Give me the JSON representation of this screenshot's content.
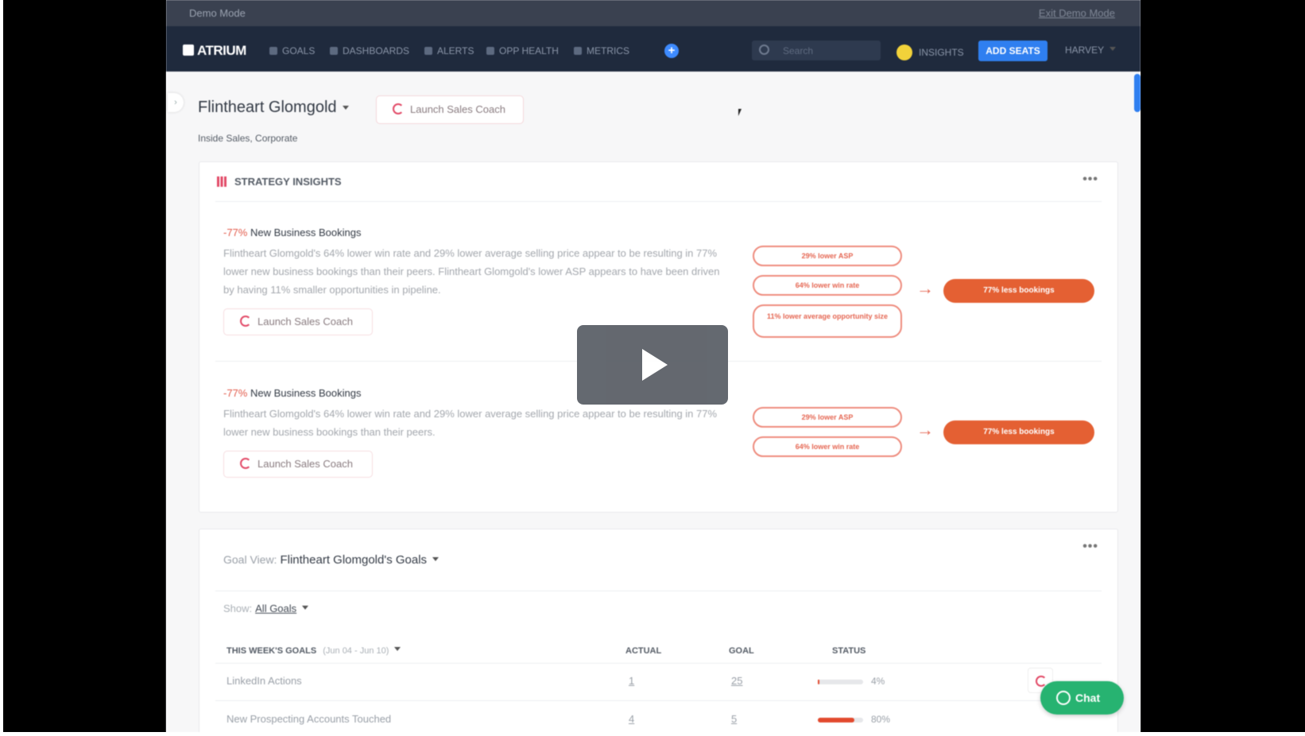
{
  "demo_bar": {
    "label": "Demo Mode",
    "exit": "Exit Demo Mode"
  },
  "nav": {
    "logo": "ATRIUM",
    "items": [
      "GOALS",
      "DASHBOARDS",
      "ALERTS",
      "OPP HEALTH",
      "METRICS"
    ],
    "search_placeholder": "Search",
    "insights": "INSIGHTS",
    "add_seats": "ADD SEATS",
    "user": "HARVEY"
  },
  "profile": {
    "name": "Flintheart Glomgold",
    "launch_coach": "Launch Sales Coach",
    "subtitle": "Inside Sales, Corporate"
  },
  "strategy": {
    "title": "STRATEGY INSIGHTS",
    "insights": [
      {
        "pct": "-77%",
        "metric": "New Business Bookings",
        "body": "Flintheart Glomgold's 64% lower win rate and 29% lower average selling price appear to be resulting in 77% lower new business bookings than their peers. Flintheart Glomgold's lower ASP appears to have been driven by having 11% smaller opportunities in pipeline.",
        "button": "Launch Sales Coach",
        "factors": [
          "29% lower ASP",
          "64% lower win rate",
          "11% lower average opportunity size"
        ],
        "result": "77% less bookings"
      },
      {
        "pct": "-77%",
        "metric": "New Business Bookings",
        "body": "Flintheart Glomgold's 64% lower win rate and 29% lower average selling price appear to be resulting in 77% lower new business bookings than their peers.",
        "button": "Launch Sales Coach",
        "factors": [
          "29% lower ASP",
          "64% lower win rate"
        ],
        "result": "77% less bookings"
      }
    ]
  },
  "goals": {
    "view_label": "Goal View:",
    "view_title": "Flintheart Glomgold's Goals",
    "show_label": "Show:",
    "show_value": "All Goals",
    "headers": {
      "period": "THIS WEEK'S GOALS",
      "range": "(Jun 04 - Jun 10)",
      "actual": "ACTUAL",
      "goal": "GOAL",
      "status": "STATUS"
    },
    "rows": [
      {
        "name": "LinkedIn Actions",
        "actual": "1",
        "goal": "25",
        "status": "4%",
        "progress": 0.04
      },
      {
        "name": "New Prospecting Accounts Touched",
        "actual": "4",
        "goal": "5",
        "status": "80%",
        "progress": 0.8
      }
    ]
  },
  "chat": "Chat",
  "colors": {
    "accent": "#e24a67",
    "result": "#e46033",
    "nav": "#1f2a3d",
    "add_seats": "#2f7ff0",
    "chat": "#27b371"
  }
}
